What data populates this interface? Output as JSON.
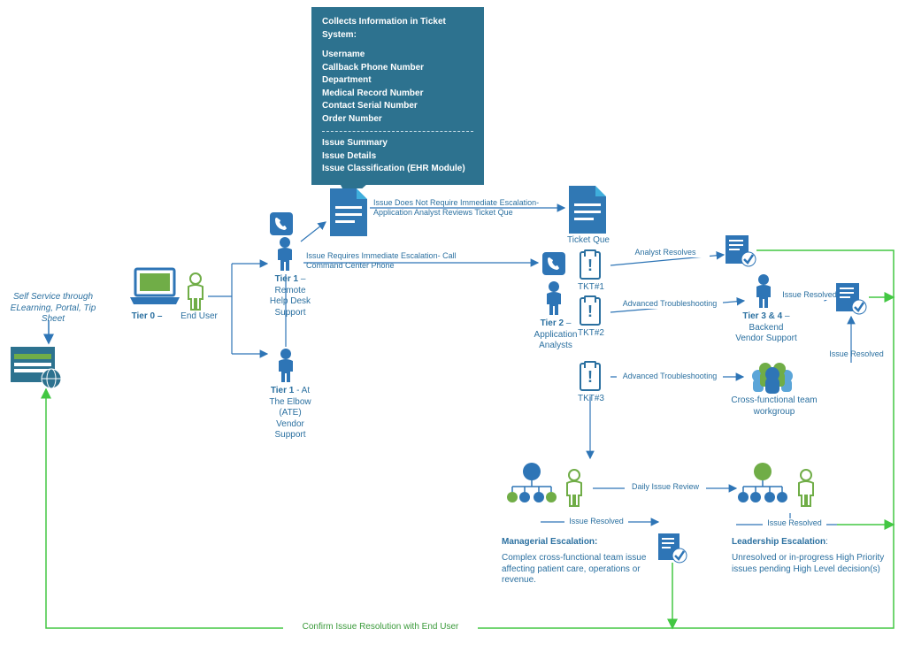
{
  "colors": {
    "blue": "#2e75b6",
    "darkteal": "#2d728f",
    "green": "#70ad47",
    "lightblue": "#5ba5d8",
    "text": "#2b70a0",
    "greenline": "#42c742"
  },
  "callout": {
    "title": "Collects Information in Ticket System:",
    "fields1": [
      "Username",
      "Callback Phone Number",
      "Department",
      "Medical Record Number",
      "Contact Serial Number",
      "Order Number"
    ],
    "fields2": [
      "Issue Summary",
      "Issue Details",
      "Issue Classification (EHR Module)"
    ]
  },
  "labels": {
    "selfService": "Self Service through ELearning, Portal, Tip Sheet",
    "tier0": "Tier 0 –",
    "endUser": "End User",
    "tier1Remote_title": "Tier 1",
    "tier1Remote_rest": " – Remote Help Desk Support",
    "tier1Ate_title": "Tier 1",
    "tier1Ate_rest": " - At The Elbow (ATE) Vendor Support",
    "tier2_title": "Tier 2",
    "tier2_rest": " – Application Analysts",
    "tier34_title": "Tier 3 & 4",
    "tier34_rest": " – Backend Vendor Support",
    "ticketQue": "Ticket Que",
    "tkt1": "TKT#1",
    "tkt2": "TKT#2",
    "tkt3": "TKT#3",
    "crossFunc": "Cross-functional team workgroup",
    "managerialTitle": "Managerial Escalation:",
    "managerialDesc": "Complex cross-functional team issue affecting patient care, operations or revenue.",
    "leadershipTitle": "Leadership Escalation",
    "leadershipDesc": "Unresolved or in-progress High Priority issues pending  High Level decision(s)",
    "confirm": "Confirm Issue Resolution with End User"
  },
  "edgeLabels": {
    "noEscalation": "Issue Does Not Require Immediate Escalation- Application Analyst Reviews Ticket Que",
    "escalation": "Issue Requires Immediate Escalation- Call Command Center Phone",
    "analystResolves": "Analyst Resolves",
    "advTrouble": "Advanced Troubleshooting",
    "issueResolved": "Issue Resolved",
    "dailyReview": "Daily Issue Review"
  }
}
